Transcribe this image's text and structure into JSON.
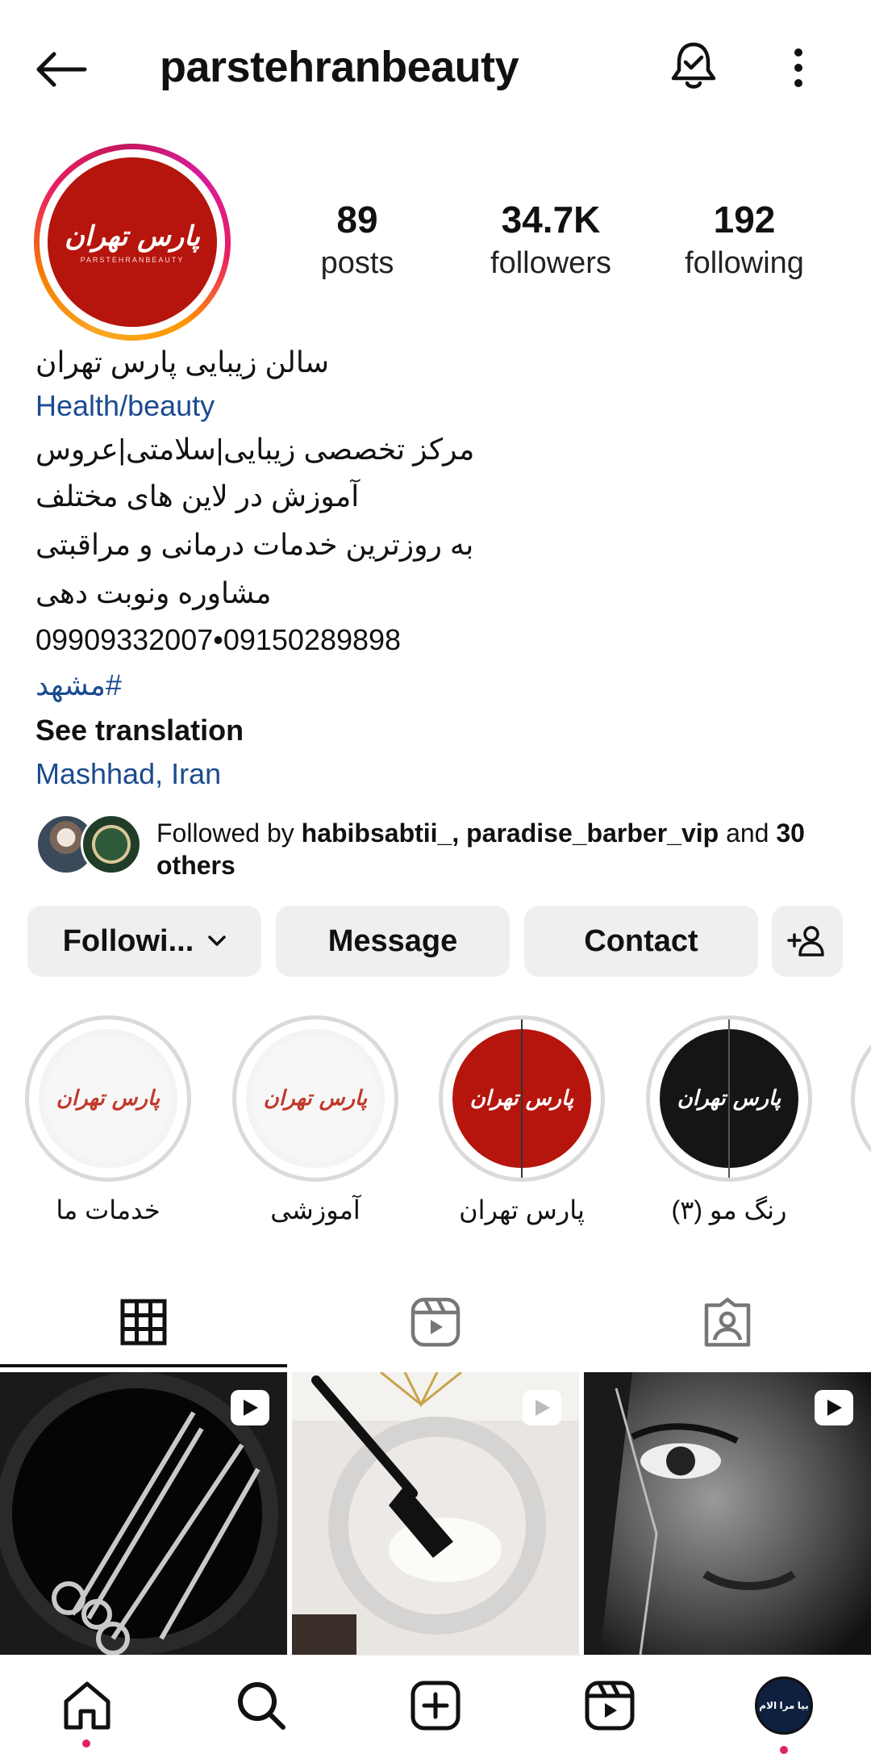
{
  "header": {
    "username": "parstehranbeauty",
    "back_icon": "arrow-left-icon",
    "bell_icon": "bell-check-icon",
    "more_icon": "vertical-dots-icon"
  },
  "profile": {
    "avatar_logo_text": "پارس تهران",
    "avatar_logo_subtext": "PARSTEHRANBEAUTY",
    "stats": [
      {
        "value": "89",
        "label": "posts"
      },
      {
        "value": "34.7K",
        "label": "followers"
      },
      {
        "value": "192",
        "label": "following"
      }
    ]
  },
  "bio": {
    "name": "سالن زیبایی پارس تهران",
    "category": "Health/beauty",
    "lines": [
      "مرکز تخصصی زیبایی|سلامتی|عروس",
      "آموزش در لاین های مختلف",
      "به روزترین خدمات درمانی و مراقبتی",
      "مشاوره ونوبت دهی",
      "09909332007•09150289898"
    ],
    "hashtag": "#مشهد",
    "see_translation": "See translation",
    "location": "Mashhad, Iran"
  },
  "followed_by": {
    "prefix": "Followed by ",
    "users": "habibsabtii_, paradise_barber_vip",
    "middle": " and ",
    "count": "30 others"
  },
  "actions": {
    "following_label": "Followi...",
    "message_label": "Message",
    "contact_label": "Contact",
    "add_person_icon": "add-person-icon"
  },
  "highlights": [
    {
      "label": "خدمات ما",
      "style": "white"
    },
    {
      "label": "آموزشی",
      "style": "white"
    },
    {
      "label": "پارس تهران",
      "style": "red"
    },
    {
      "label": "رنگ مو (۳)",
      "style": "black"
    }
  ],
  "tabs": [
    {
      "name": "grid-icon",
      "active": true
    },
    {
      "name": "reels-icon",
      "active": false
    },
    {
      "name": "tagged-icon",
      "active": false
    }
  ],
  "posts": [
    {
      "subject": "scissors",
      "reel": true
    },
    {
      "subject": "hair-dye-brush",
      "reel": true
    },
    {
      "subject": "face-portrait",
      "reel": true
    }
  ],
  "bottom_nav": {
    "items": [
      "home-icon",
      "search-icon",
      "create-icon",
      "reels-icon",
      "profile-avatar"
    ],
    "profile_avatar_text": "بیا مرا الام"
  },
  "colors": {
    "link": "#1b4b8f",
    "brand_red": "#b5150d",
    "button_bg": "#efefef",
    "notification_dot": "#e0245e"
  }
}
